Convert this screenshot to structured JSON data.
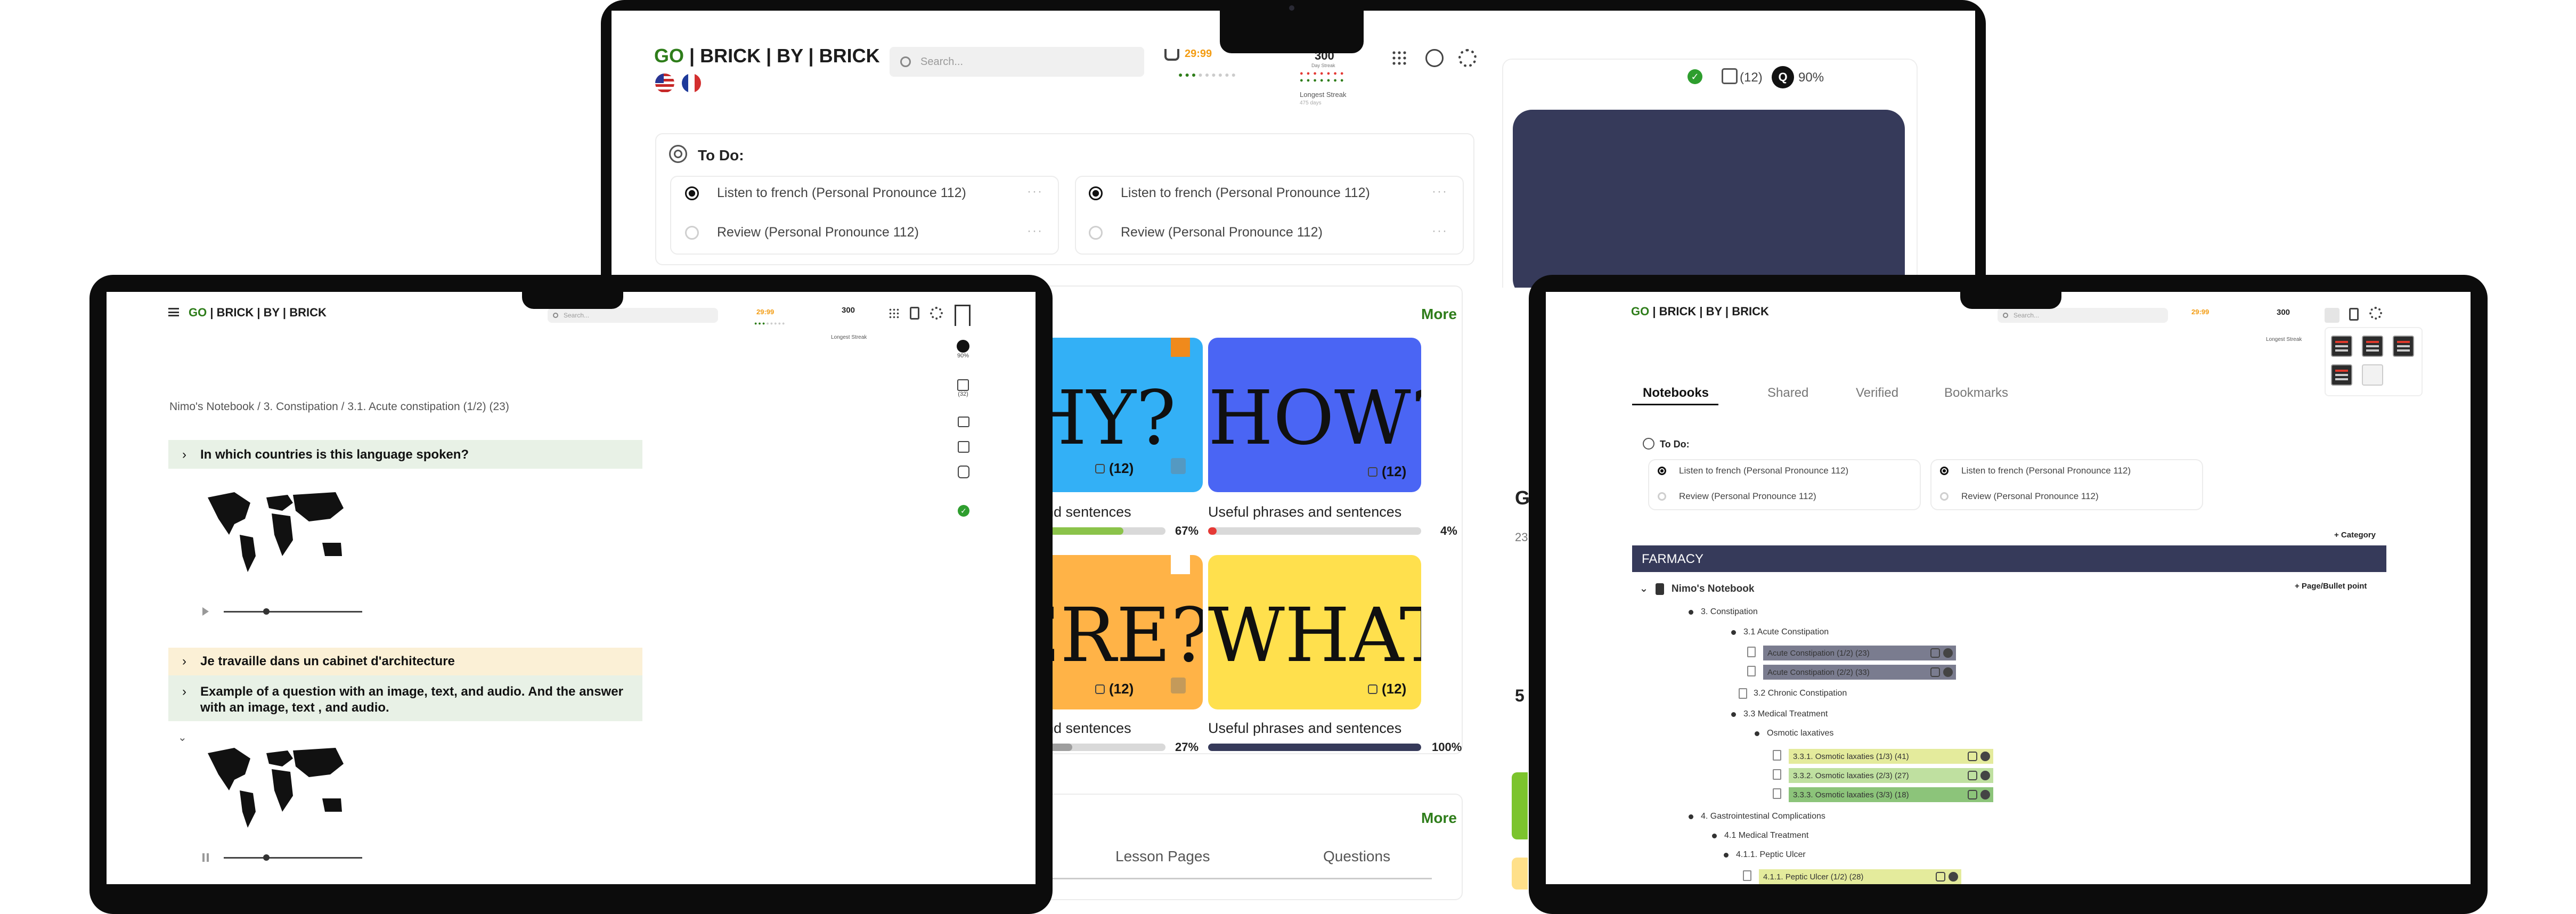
{
  "brand": {
    "go": "GO",
    "rest": " | BRICK | BY | BRICK"
  },
  "search": {
    "placeholder": "Search..."
  },
  "header": {
    "timer": "29:99",
    "streak_value": "300",
    "streak_sub": "Day Streak",
    "longest_streak": "Longest Streak",
    "longest_sub": "475 days"
  },
  "colors": {
    "brand_green": "#2e7d1a",
    "navy": "#363a5a",
    "blue_tile": "#4a65f4",
    "cyan_tile": "#33b0f6",
    "orange_tile": "#ffb347",
    "yellow_tile": "#ffe04d",
    "farmacy_bar": "#363a5a"
  },
  "top": {
    "status_count": "(12)",
    "status_pct": "90%",
    "todo_title": "To Do:",
    "todos": [
      {
        "label": "Listen to french (Personal Pronounce 112)",
        "done": true
      },
      {
        "label": "Listen to french (Personal Pronounce 112)",
        "done": true
      },
      {
        "label": "Review (Personal Pronounce 112)",
        "done": false
      },
      {
        "label": "Review (Personal Pronounce 112)",
        "done": false
      }
    ],
    "more_1": "More",
    "more_2": "More",
    "tiles": [
      {
        "word": "HY?",
        "count": "(12)",
        "caption": "and sentences",
        "pct": "67%",
        "progress": 0.67,
        "fill": "#8bc34a"
      },
      {
        "word": "HOW?",
        "count": "(12)",
        "caption": "Useful phrases and sentences",
        "pct": "4%",
        "progress": 0.04,
        "fill": "#e53935"
      },
      {
        "word": "ERE?",
        "count": "(12)",
        "caption": "and sentences",
        "pct": "27%",
        "progress": 0.27,
        "fill": "#9e9e9e"
      },
      {
        "word": "WHAT?",
        "count": "(12)",
        "caption": "Useful phrases and sentences",
        "pct": "100%",
        "progress": 1.0,
        "fill": "#363a5a"
      }
    ],
    "tabs": [
      "Lesson Pages",
      "Questions"
    ],
    "side_letters": [
      "G",
      "23",
      "5"
    ]
  },
  "left": {
    "breadcrumb": "Nimo's Notebook / 3. Constipation / 3.1. Acute constipation (1/2) (23)",
    "q1": "In which countries is this language spoken?",
    "q2": "Je travaille dans un cabinet d'architecture",
    "q3": "Example of a question with an image, text, and audio. And the answer with an image, text , and audio.",
    "side_pct": "90%",
    "side_count": "(32)"
  },
  "right": {
    "tabs": [
      "Notebooks",
      "Shared",
      "Verified",
      "Bookmarks"
    ],
    "todo_title": "To Do:",
    "todos": [
      {
        "label": "Listen to french (Personal Pronounce 112)",
        "done": true
      },
      {
        "label": "Listen to french (Personal Pronounce 112)",
        "done": true
      },
      {
        "label": "Review (Personal Pronounce 112)",
        "done": false
      },
      {
        "label": "Review (Personal Pronounce 112)",
        "done": false
      }
    ],
    "add_category": "+ Category",
    "farmacy": "FARMACY",
    "notebook": "Nimo's Notebook",
    "add_page": "+ Page/Bullet point",
    "tree": [
      "3. Constipation",
      "3.1 Acute Constipation",
      "Acute Constipation (1/2) (23)",
      "Acute Constipation (2/2) (33)",
      "3.2 Chronic Constipation",
      "3.3 Medical Treatment",
      "Osmotic laxatives",
      "3.3.1. Osmotic laxaties (1/3) (41)",
      "3.3.2. Osmotic laxaties (2/3) (27)",
      "3.3.3. Osmotic laxaties (3/3) (18)",
      "4. Gastrointestinal Complications",
      "4.1 Medical Treatment",
      "4.1.1. Peptic Ulcer",
      "4.1.1. Peptic Ulcer (1/2) (28)"
    ]
  }
}
